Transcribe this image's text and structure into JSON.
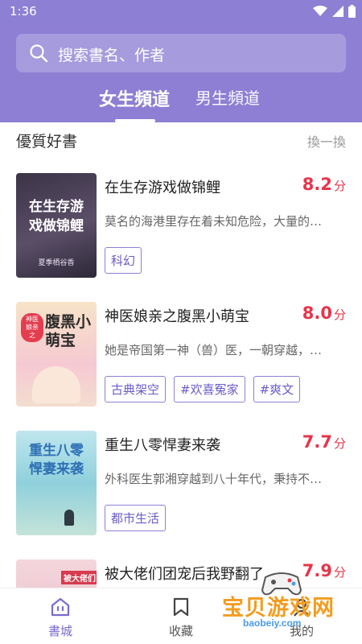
{
  "status_bar": {
    "time": "1:36"
  },
  "search": {
    "placeholder": "搜索書名、作者"
  },
  "tabs": [
    {
      "label": "女生頻道",
      "active": true
    },
    {
      "label": "男生頻道",
      "active": false
    }
  ],
  "section": {
    "title": "優質好書",
    "refresh": "換一換"
  },
  "books": [
    {
      "title": "在生存游戏做锦鲤",
      "score": "8.2",
      "score_unit": "分",
      "desc": "莫名的海港里存在着未知危险，大量的…",
      "tags": [
        "科幻"
      ],
      "cover_title": "在生存游戏做锦鲤",
      "cover_author": "夏季栖谷香"
    },
    {
      "title": "神医娘亲之腹黑小萌宝",
      "score": "8.0",
      "score_unit": "分",
      "desc": "她是帝国第一神（兽）医，一朝穿越，…",
      "tags": [
        "古典架空",
        "#欢喜冤家",
        "#爽文"
      ],
      "cover_title": "腹黑小萌宝",
      "cover_badge": "神医娘亲之"
    },
    {
      "title": "重生八零悍妻来袭",
      "score": "7.7",
      "score_unit": "分",
      "desc": "外科医生郭湘穿越到八十年代，秉持不…",
      "tags": [
        "都市生活"
      ],
      "cover_title": "重生八零悍妻来袭"
    },
    {
      "title": "被大佬们团宠后我野翻了",
      "score": "7.9",
      "score_unit": "分",
      "desc": "",
      "tags": [],
      "cover_title": "被大佬们"
    }
  ],
  "nav": [
    {
      "label": "書城",
      "icon": "home-icon",
      "active": true
    },
    {
      "label": "收藏",
      "icon": "bookmark-icon",
      "active": false
    },
    {
      "label": "我的",
      "icon": "profile-icon",
      "active": false
    }
  ],
  "watermark": {
    "text": "宝贝游戏网",
    "url": "baobeiy.com"
  },
  "colors": {
    "header": "#8e7fd4",
    "score": "#e8344a",
    "tag": "#6a5cc9"
  }
}
